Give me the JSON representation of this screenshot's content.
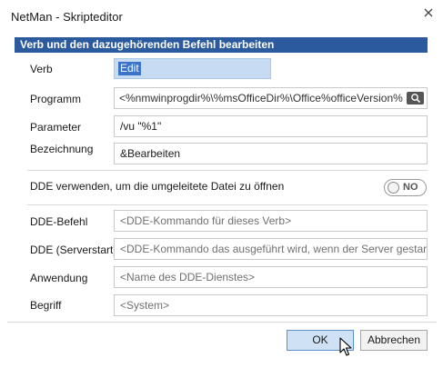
{
  "window": {
    "title": "NetMan - Skripteditor"
  },
  "section": {
    "title": "Verb und den dazugehörenden Befehl bearbeiten"
  },
  "fields": {
    "verb": {
      "label": "Verb",
      "value": "Edit"
    },
    "programm": {
      "label": "Programm",
      "value": "<%nmwinprogdir%\\%msOfficeDir%\\Office%officeVersion%\\..."
    },
    "parameter": {
      "label": "Parameter",
      "value": "/vu \"%1\""
    },
    "bezeichnung": {
      "label": "Bezeichnung",
      "value": "&Bearbeiten"
    },
    "dde_toggle": {
      "label": "DDE verwenden, um die umgeleitete Datei zu öffnen",
      "state": "NO"
    },
    "dde_befehl": {
      "label": "DDE-Befehl",
      "placeholder": "<DDE-Kommando für dieses Verb>"
    },
    "dde_serverstart": {
      "label": "DDE (Serverstart)",
      "placeholder": "<DDE-Kommando das ausgeführt wird, wenn der Server gestartet ..."
    },
    "anwendung": {
      "label": "Anwendung",
      "placeholder": "<Name des DDE-Dienstes>"
    },
    "begriff": {
      "label": "Begriff",
      "placeholder": "<System>"
    }
  },
  "buttons": {
    "ok": "OK",
    "cancel": "Abbrechen"
  },
  "colors": {
    "header_bg": "#2b5a9e",
    "ok_bg": "#cfe1f5"
  }
}
